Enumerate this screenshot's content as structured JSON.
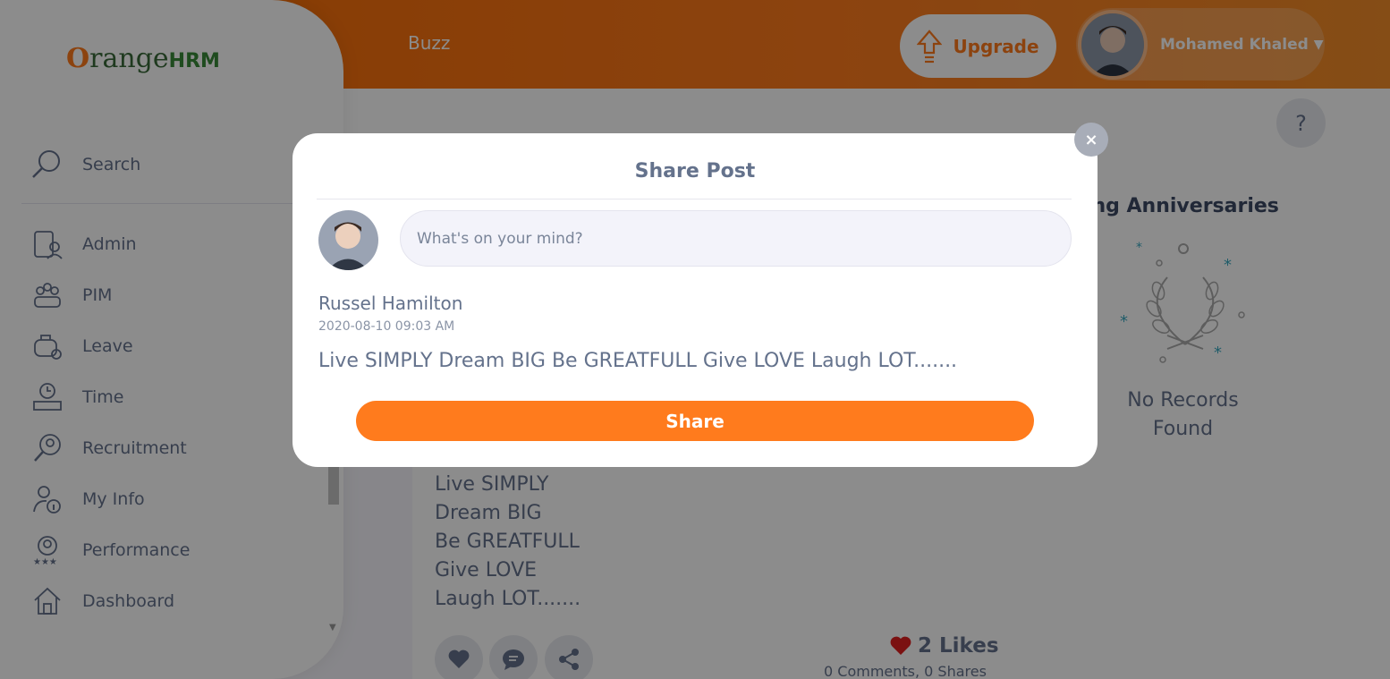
{
  "header": {
    "section_title": "Buzz",
    "upgrade_label": "Upgrade",
    "user_name": "Mohamed Khaled",
    "help_label": "?"
  },
  "sidebar": {
    "logo_o": "O",
    "logo_range": "range",
    "logo_hrm": "HRM",
    "search_label": "Search",
    "items": [
      {
        "label": "Admin",
        "icon": "admin-icon"
      },
      {
        "label": "PIM",
        "icon": "pim-icon"
      },
      {
        "label": "Leave",
        "icon": "leave-icon"
      },
      {
        "label": "Time",
        "icon": "time-icon"
      },
      {
        "label": "Recruitment",
        "icon": "recruitment-icon"
      },
      {
        "label": "My Info",
        "icon": "my-info-icon"
      },
      {
        "label": "Performance",
        "icon": "performance-icon"
      },
      {
        "label": "Dashboard",
        "icon": "dashboard-icon"
      }
    ]
  },
  "post": {
    "lines": [
      "Live SIMPLY",
      "Dream BIG",
      "Be GREATFULL",
      "Give LOVE",
      "Laugh LOT......."
    ],
    "likes": "2 Likes",
    "counts": "0 Comments, 0 Shares"
  },
  "anniversaries": {
    "title": "ming Anniversaries",
    "empty_line1": "No Records",
    "empty_line2": "Found"
  },
  "modal": {
    "title": "Share Post",
    "input_placeholder": "What's on your mind?",
    "author": "Russel Hamilton",
    "timestamp": "2020-08-10 09:03 AM",
    "text": "Live SIMPLY Dream BIG Be GREATFULL Give LOVE Laugh LOT.......",
    "share_label": "Share",
    "close_label": "×"
  },
  "colors": {
    "accent": "#ff7b1d",
    "text": "#64728c"
  }
}
